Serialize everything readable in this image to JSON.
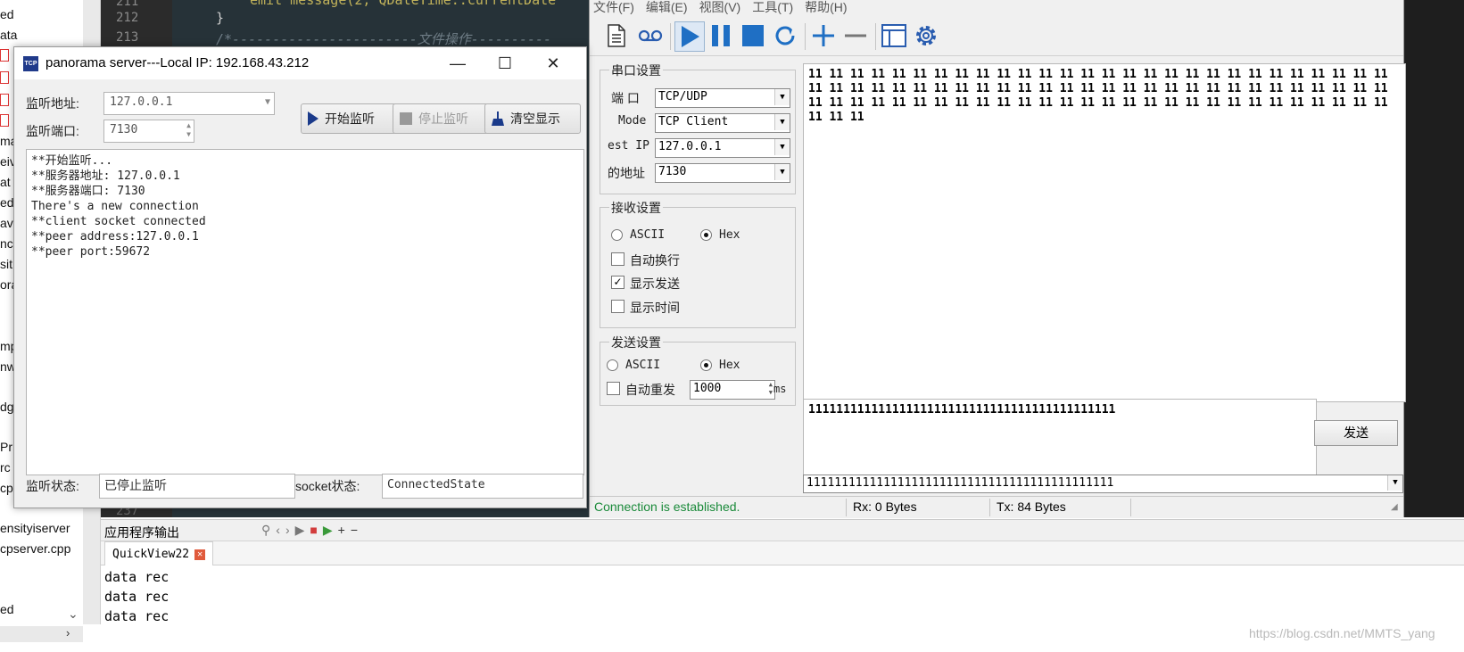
{
  "ide": {
    "tree_items": [
      "ed",
      "ata",
      "ma",
      "eiv",
      "at",
      "ed",
      "av",
      "ncl",
      "sit",
      "ora",
      "mp",
      "nw",
      "dg",
      "Pr",
      "rc",
      "cp",
      "ensityiserver",
      "cpserver.cpp",
      "ed"
    ],
    "line_numbers": [
      "211",
      "212",
      "213",
      "237"
    ],
    "code_brace": "}",
    "code_comment": "/*-----------------------文件操作----------",
    "code_top": "emit message(2, QDateTime::currentDate"
  },
  "output": {
    "header": "应用程序输出",
    "tab_label": "QuickView22",
    "tab_close": "✕",
    "lines": [
      "data rec",
      "data rec",
      "data rec"
    ],
    "watermark": "https://blog.csdn.net/MMTS_yang"
  },
  "panorama": {
    "title": "panorama server---Local IP: 192.168.43.212",
    "icon_text": "TCP",
    "listen_addr_label": "监听地址:",
    "listen_addr_value": "127.0.0.1",
    "listen_port_label": "监听端口:",
    "listen_port_value": "7130",
    "btn_start": "开始监听",
    "btn_stop": "停止监听",
    "btn_clear": "清空显示",
    "log": [
      "**开始监听...",
      "**服务器地址: 127.0.0.1",
      "**服务器端口: 7130",
      "There's a new connection",
      "**client socket connected",
      "**peer address:127.0.0.1",
      "**peer port:59672"
    ],
    "listen_status_label": "监听状态:",
    "listen_status_value": "已停止监听",
    "socket_status_label": "socket状态:",
    "socket_status_value": "ConnectedState"
  },
  "serial": {
    "menu": [
      "文件(F)",
      "编辑(E)",
      "视图(V)",
      "工具(T)",
      "帮助(H)"
    ],
    "port_group": "串口设置",
    "port_label": "端  口",
    "port_value": "TCP/UDP",
    "mode_label": "Mode",
    "mode_value": "TCP Client",
    "dest_ip_label": "est IP",
    "dest_ip_value": "127.0.0.1",
    "dest_port_label": "的地址",
    "dest_port_value": "7130",
    "recv_group": "接收设置",
    "recv_ascii": "ASCII",
    "recv_hex": "Hex",
    "auto_wrap": "自动换行",
    "show_send": "显示发送",
    "show_time": "显示时间",
    "send_group": "发送设置",
    "send_ascii": "ASCII",
    "send_hex": "Hex",
    "auto_resend": "自动重发",
    "interval_value": "1000",
    "interval_unit": "ms",
    "recv_lines": [
      "11 11 11 11 11 11 11 11 11 11 11 11 11 11 11 11 11 11 11 11 11 11 11 11 11 11 11 11",
      "11 11 11 11 11 11 11 11 11 11 11 11 11 11 11 11 11 11 11 11 11 11 11 11 11 11 11 11",
      "11 11 11 11 11 11 11 11 11 11 11 11 11 11 11 11 11 11 11 11 11 11 11 11 11 11 11 11",
      "11 11 11"
    ],
    "send_text": "11111111111111111111111111111111111111111111",
    "send_button": "发送",
    "history_value": "11111111111111111111111111111111111111111111",
    "status_conn": "Connection is established.",
    "status_rx": "Rx: 0 Bytes",
    "status_tx": "Tx: 84 Bytes"
  }
}
